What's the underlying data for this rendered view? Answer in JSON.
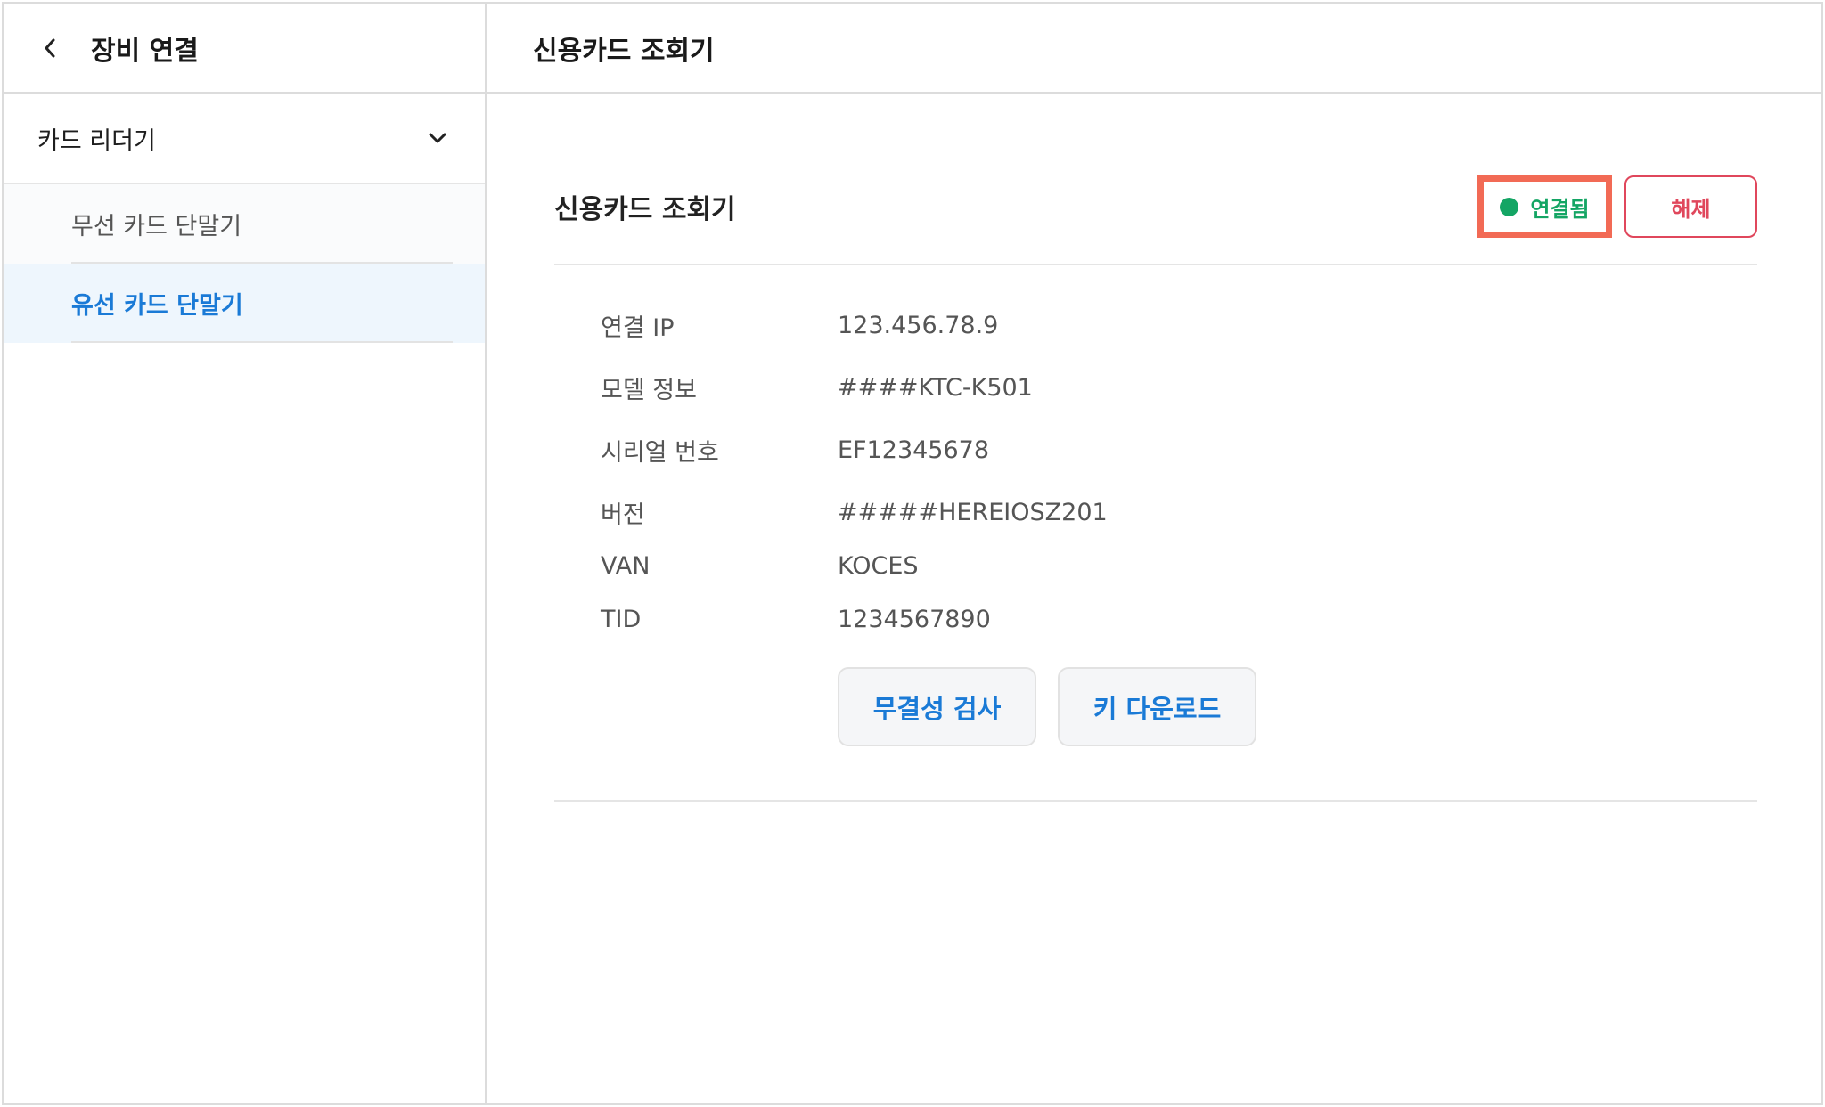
{
  "sidebar": {
    "title": "장비 연결",
    "group": {
      "label": "카드 리더기"
    },
    "items": [
      {
        "label": "무선 카드 단말기",
        "active": false
      },
      {
        "label": "유선 카드 단말기",
        "active": true
      }
    ]
  },
  "main": {
    "header_title": "신용카드 조회기",
    "panel": {
      "title": "신용카드 조회기",
      "status": {
        "label": "연결됨",
        "color": "#14a564"
      },
      "disconnect_label": "해제",
      "info": [
        {
          "label": "연결 IP",
          "value": "123.456.78.9"
        },
        {
          "label": "모델 정보",
          "value": "####KTC-K501"
        },
        {
          "label": "시리얼 번호",
          "value": "EF12345678"
        },
        {
          "label": "버전",
          "value": "#####HEREIOSZ201"
        },
        {
          "label": "VAN",
          "value": "KOCES"
        },
        {
          "label": "TID",
          "value": "1234567890"
        }
      ],
      "buttons": {
        "integrity": "무결성 검사",
        "key_download": "키 다운로드"
      }
    }
  },
  "colors": {
    "accent": "#1a7ad6",
    "danger": "#e0475c",
    "highlight_border": "#f26a55",
    "active_item_bg": "#eef6fd"
  },
  "icons": [
    "chevron-left-icon",
    "chevron-down-icon",
    "status-dot-icon"
  ]
}
